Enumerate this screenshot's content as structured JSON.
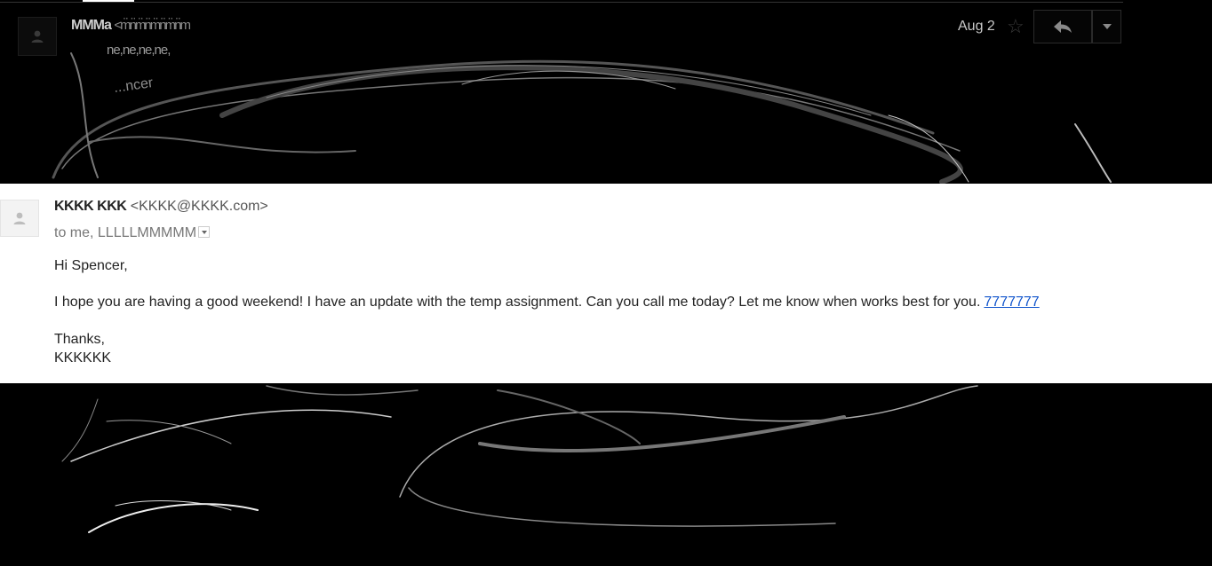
{
  "thread": {
    "collapsed_message": {
      "sender_name": "MMMa",
      "sender_address": "<m̈n̈m̈n̈m̈n̈m̈n̈m",
      "recipients": "ne,ne,ne,ne,",
      "snippet": "...ncer",
      "date": "Aug 2"
    },
    "expanded_message": {
      "sender_name": "KKKK KKK",
      "sender_address": "<KKKK@KKKK.com>",
      "to_line": "to me, LLLLLMMMMM",
      "greeting": "Hi Spencer,",
      "paragraph": "I hope you are having a good weekend! I have an update with the temp assignment. Can you call me today? Let me know when works best for you.",
      "phone_link": "7777777",
      "closing": "Thanks,",
      "signature": "KKKKKK"
    }
  },
  "icons": {
    "avatar": "person-icon",
    "star": "star-icon",
    "reply": "reply-icon",
    "more": "chevron-down-icon"
  },
  "colors": {
    "link": "#1155cc",
    "background": "#000000",
    "message_bg": "#ffffff"
  }
}
